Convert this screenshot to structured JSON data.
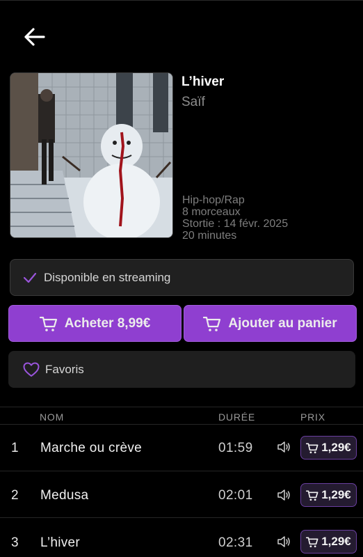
{
  "header": {
    "back_icon": "arrow-left-icon"
  },
  "album": {
    "title": "L’hiver",
    "artist": "Saïf",
    "genre": "Hip-hop/Rap",
    "tracks_count": "8 morceaux",
    "release": "Stortie : 14 févr. 2025",
    "duration": "20 minutes"
  },
  "streaming": {
    "label": "Disponible en streaming",
    "icon": "check-icon"
  },
  "actions": {
    "buy_label": "Acheter 8,99€",
    "add_cart_label": "Ajouter au panier",
    "favorite_label": "Favoris"
  },
  "table": {
    "columns": {
      "name": "NOM",
      "duration": "DURÉE",
      "price": "PRIX"
    },
    "rows": [
      {
        "num": "1",
        "name": "Marche ou crève",
        "duration": "01:59",
        "price": "1,29€"
      },
      {
        "num": "2",
        "name": "Medusa",
        "duration": "02:01",
        "price": "1,29€"
      },
      {
        "num": "3",
        "name": "L’hiver",
        "duration": "02:31",
        "price": "1,29€"
      }
    ]
  },
  "colors": {
    "accent": "#8f3fd0",
    "background": "#000000",
    "card": "#202020"
  }
}
